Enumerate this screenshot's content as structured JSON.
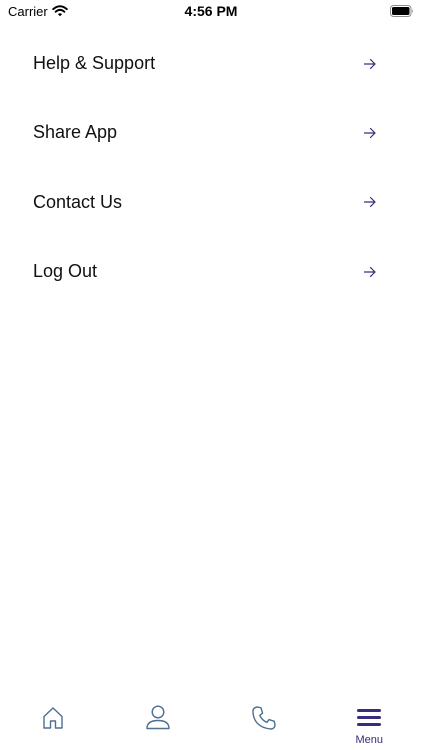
{
  "status_bar": {
    "carrier": "Carrier",
    "time": "4:56 PM"
  },
  "menu": {
    "items": [
      {
        "label": "Help & Support",
        "icon": "arrow-right-icon"
      },
      {
        "label": "Share App",
        "icon": "arrow-right-icon"
      },
      {
        "label": "Contact Us",
        "icon": "arrow-right-icon"
      },
      {
        "label": "Log Out",
        "icon": "arrow-right-icon"
      }
    ]
  },
  "tab_bar": {
    "tabs": [
      {
        "icon": "home-icon",
        "label": ""
      },
      {
        "icon": "profile-icon",
        "label": ""
      },
      {
        "icon": "phone-icon",
        "label": ""
      },
      {
        "icon": "menu-icon",
        "label": "Menu",
        "selected": true
      }
    ]
  },
  "colors": {
    "accent": "#3c2a7a",
    "inactive_icon": "#4f6f8f",
    "text": "#111111",
    "background": "#ffffff"
  }
}
